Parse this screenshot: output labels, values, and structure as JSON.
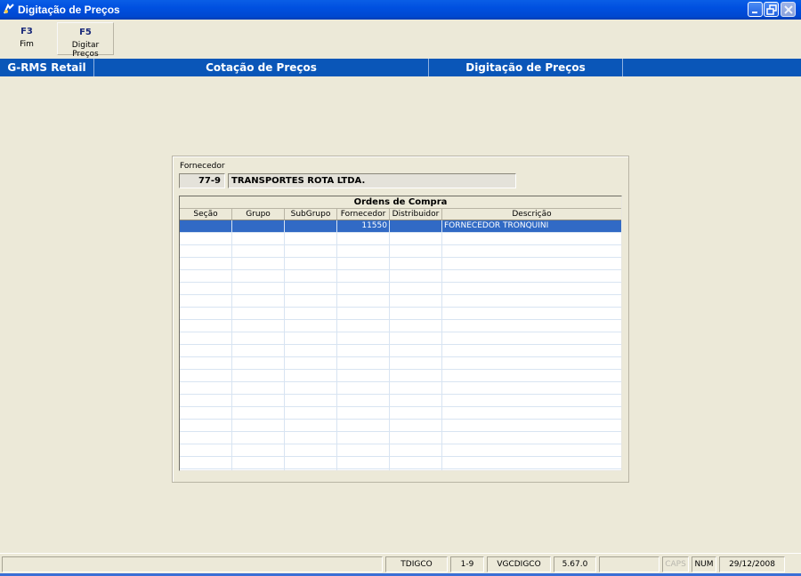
{
  "window": {
    "title": "Digitação de Preços"
  },
  "toolbar": [
    {
      "key": "F3",
      "label": "Fim"
    },
    {
      "key": "F5",
      "label": "Digitar Preços"
    }
  ],
  "nav": [
    "G-RMS Retail",
    "Cotação de Preços",
    "Digitação de Preços"
  ],
  "supplier": {
    "label": "Fornecedor",
    "code": "77-9",
    "name": "TRANSPORTES ROTA LTDA."
  },
  "grid": {
    "title": "Ordens de Compra",
    "columns": [
      "Seção",
      "Grupo",
      "SubGrupo",
      "Fornecedor",
      "Distribuidor",
      "Descrição"
    ],
    "rows": [
      {
        "secao": "",
        "grupo": "",
        "subgrupo": "",
        "fornecedor": "11550",
        "distribuidor": "",
        "descricao": "FORNECEDOR TRONQUINI"
      }
    ]
  },
  "status": [
    "",
    "TDIGCO",
    "1-9",
    "VGCDIGCO",
    "5.67.0",
    "",
    "CAPS",
    "NUM",
    "29/12/2008"
  ]
}
